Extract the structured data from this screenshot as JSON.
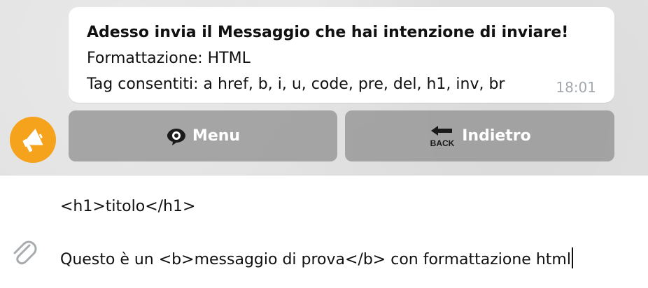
{
  "message": {
    "title": "Adesso invia il Messaggio che hai intenzione di inviare!",
    "line2": "Formattazione: HTML",
    "line3": "Tag consentiti: a href, b, i, u, code, pre, del, h1, inv, br",
    "time": "18:01"
  },
  "avatar": {
    "icon": "megaphone-icon",
    "color": "#f5a21c"
  },
  "keyboard": {
    "buttons": [
      {
        "label": "Menu",
        "icon": "eye-icon"
      },
      {
        "label": "Indietro",
        "icon": "back-arrow-icon",
        "icon_text": "BACK"
      }
    ]
  },
  "composer": {
    "lines": [
      "<h1>titolo</h1>",
      "",
      "Questo è un <b>messaggio di prova</b> con formattazione html"
    ],
    "attach_icon": "paperclip-icon"
  }
}
